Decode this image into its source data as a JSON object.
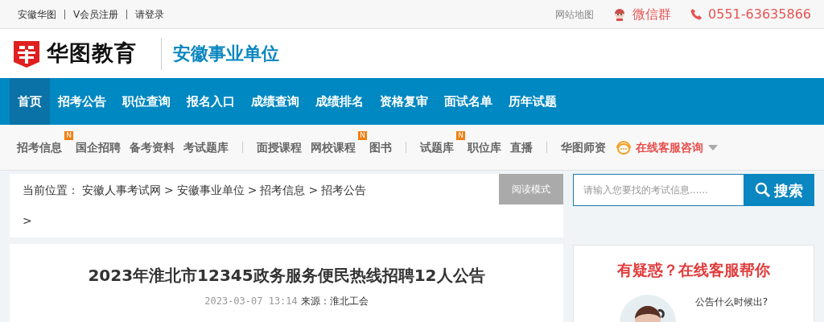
{
  "top_bar": {
    "left_links": [
      "安徽华图",
      "V会员注册",
      "请登录"
    ],
    "site_map": "网站地图",
    "wechat_group": "微信群",
    "phone": "0551-63635866"
  },
  "header": {
    "logo_text": "华图教育",
    "site_name": "安徽事业单位"
  },
  "main_nav": [
    {
      "label": "首页",
      "selected": true
    },
    {
      "label": "招考公告",
      "selected": false
    },
    {
      "label": "职位查询",
      "selected": false
    },
    {
      "label": "报名入口",
      "selected": false
    },
    {
      "label": "成绩查询",
      "selected": false
    },
    {
      "label": "成绩排名",
      "selected": false
    },
    {
      "label": "资格复审",
      "selected": false
    },
    {
      "label": "面试名单",
      "selected": false
    },
    {
      "label": "历年试题",
      "selected": false
    }
  ],
  "sub_nav": [
    {
      "kind": "link",
      "label": "招考信息",
      "badge": "N"
    },
    {
      "kind": "link",
      "label": "国企招聘"
    },
    {
      "kind": "link",
      "label": "备考资料"
    },
    {
      "kind": "link",
      "label": "考试题库"
    },
    {
      "kind": "separator"
    },
    {
      "kind": "link",
      "label": "面授课程"
    },
    {
      "kind": "link",
      "label": "网校课程",
      "badge": "N"
    },
    {
      "kind": "link",
      "label": "图书"
    },
    {
      "kind": "separator"
    },
    {
      "kind": "link",
      "label": "试题库",
      "badge": "N"
    },
    {
      "kind": "link",
      "label": "职位库"
    },
    {
      "kind": "link",
      "label": "直播"
    },
    {
      "kind": "separator"
    },
    {
      "kind": "link",
      "label": "华图师资"
    },
    {
      "kind": "service",
      "label": "在线客服咨询"
    }
  ],
  "breadcrumb": {
    "prefix": "当前位置：",
    "items": [
      "安徽人事考试网",
      "安徽事业单位",
      "招考信息",
      "招考公告"
    ],
    "separator": ">",
    "trailing": ">"
  },
  "read_mode_button": "阅读模式",
  "article": {
    "title": "2023年淮北市12345政务服务便民热线招聘12人公告",
    "date": "2023-03-07 13:14",
    "source": "来源：淮北工会"
  },
  "search": {
    "placeholder": "请输入您要找的考试信息......",
    "button": "搜索"
  },
  "help_card": {
    "title": "有疑惑？在线客服帮你",
    "question": "公告什么时候出?"
  }
}
